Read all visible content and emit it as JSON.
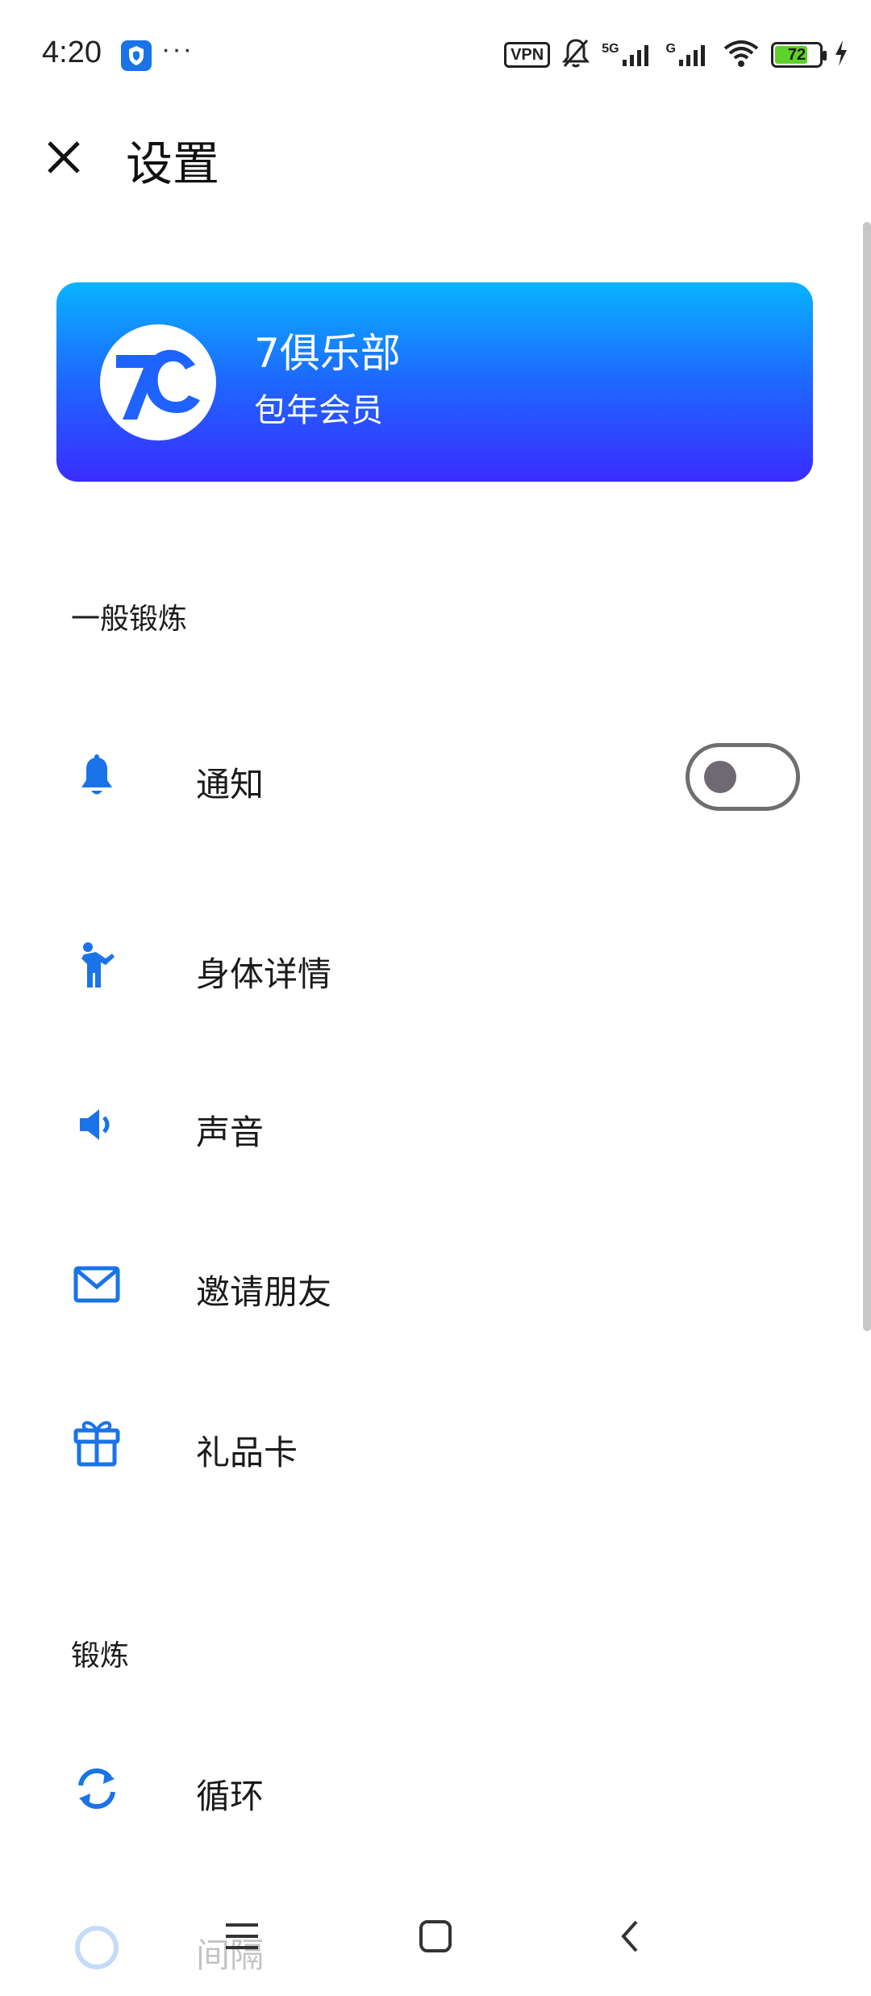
{
  "status_bar": {
    "time": "4:20",
    "dots": "···",
    "vpn": "VPN",
    "net1": "5G",
    "net2": "G",
    "battery": "72",
    "battery_level": 0.72
  },
  "header": {
    "title": "设置"
  },
  "club_card": {
    "name": "7俱乐部",
    "subtitle": "包年会员",
    "logo_text": "7C"
  },
  "sections": {
    "general": "一般锻炼",
    "workout": "锻炼"
  },
  "items": {
    "notification": "通知",
    "body_details": "身体详情",
    "sound": "声音",
    "invite": "邀请朋友",
    "gift_card": "礼品卡",
    "loop": "循环",
    "interval": "间隔"
  },
  "toggles": {
    "notification_on": false
  },
  "colors": {
    "accent": "#1a73e8",
    "card_top": "#08b4ff",
    "card_bottom": "#3a2cff"
  },
  "icons": {
    "close": "close-icon",
    "bell": "bell-icon",
    "person": "person-icon",
    "speaker": "speaker-icon",
    "mail": "mail-icon",
    "gift": "gift-icon",
    "loop": "loop-icon",
    "interval": "interval-icon"
  }
}
